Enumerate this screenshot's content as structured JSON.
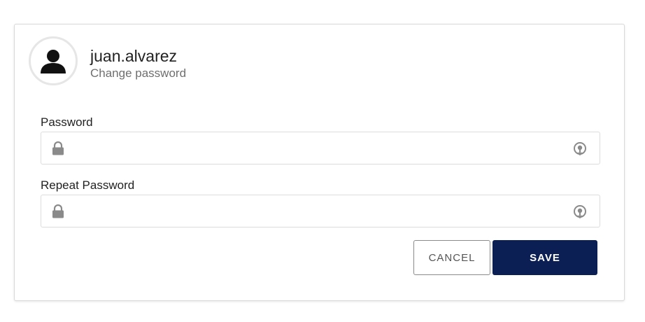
{
  "user": {
    "username": "juan.alvarez",
    "subtitle": "Change password"
  },
  "form": {
    "password_label": "Password",
    "password_value": "",
    "repeat_label": "Repeat Password",
    "repeat_value": ""
  },
  "actions": {
    "cancel_label": "CANCEL",
    "save_label": "SAVE"
  },
  "icons": {
    "avatar": "user-icon",
    "field_lock": "lock-icon",
    "field_reveal": "eye-reveal-icon"
  },
  "colors": {
    "primary": "#0b1f54",
    "icon_gray": "#8a8a8a"
  }
}
